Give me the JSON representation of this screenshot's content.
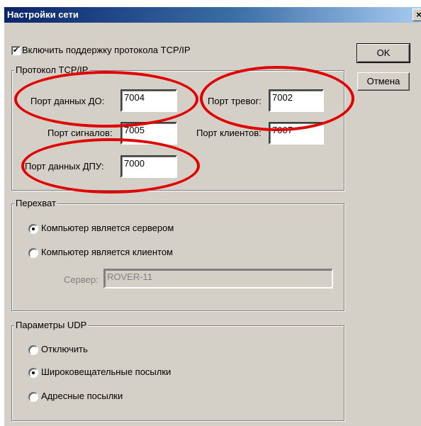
{
  "window": {
    "title": "Настройки сети",
    "close_label": "×"
  },
  "buttons": {
    "ok_label": "OK",
    "cancel_label": "Отмена"
  },
  "tcp": {
    "enable_label": "Включить поддержку протокола TCP/IP",
    "enable_checked": true,
    "check_mark": "✔",
    "group_label": "Протокол TCP/IP",
    "port_do_label": "Порт данных ДО:",
    "port_do_value": "7004",
    "port_alarm_label": "Порт тревог:",
    "port_alarm_value": "7002",
    "port_signals_label": "Порт сигналов:",
    "port_signals_value": "7005",
    "port_clients_label": "Порт клиентов:",
    "port_clients_value": "7007",
    "port_dpu_label": "Порт данных ДПУ:",
    "port_dpu_value": "7000"
  },
  "intercept": {
    "group_label": "Перехват",
    "server_label": "Компьютер является сервером",
    "client_label": "Компьютер является клиентом",
    "selected": "server",
    "server_field_label": "Сервер:",
    "server_field_value": "ROVER-11"
  },
  "udp": {
    "group_label": "Параметры UDP",
    "off_label": "Отключить",
    "broadcast_label": "Широковещательные посылки",
    "address_label": "Адресные посылки",
    "selected": "broadcast"
  },
  "annotation_color": "#e00000"
}
